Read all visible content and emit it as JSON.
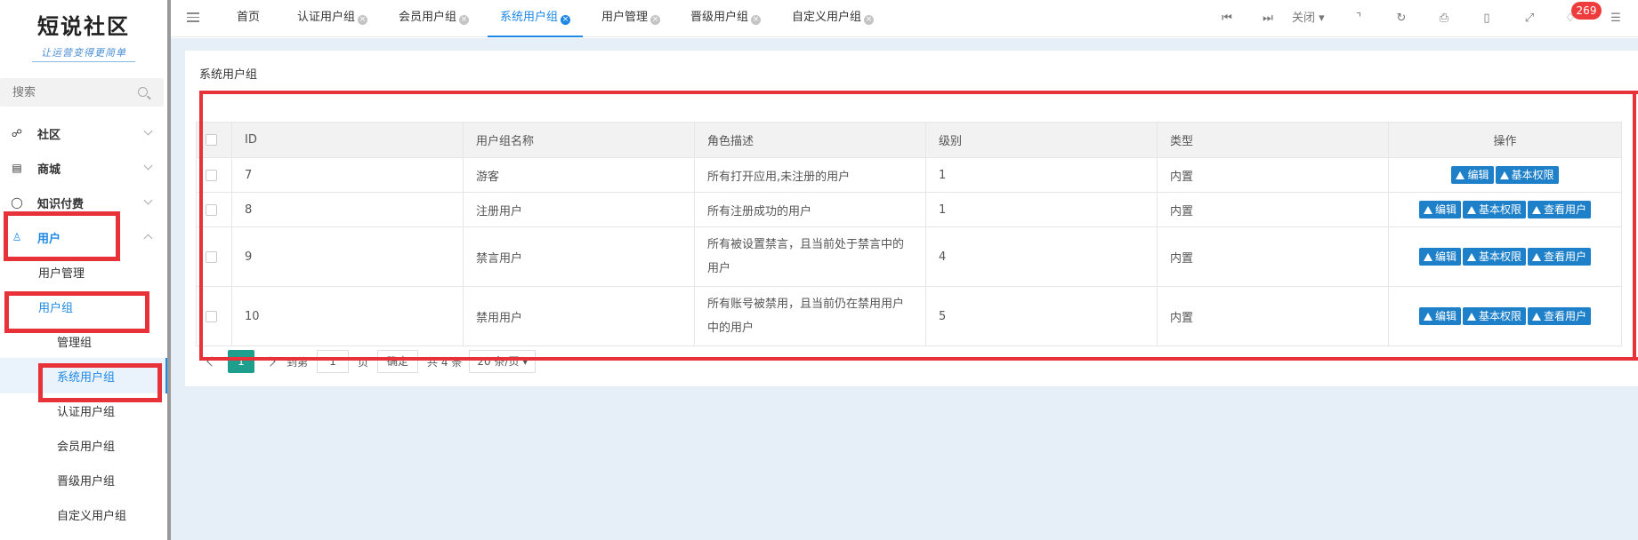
{
  "sidebar": {
    "logo_title": "短说社区",
    "logo_subtitle": "让运营变得更简单",
    "search_placeholder": "搜索",
    "menu": [
      {
        "label": "社区",
        "icon": "chat-icon"
      },
      {
        "label": "商城",
        "icon": "store-icon"
      },
      {
        "label": "知识付费",
        "icon": "bulb-icon"
      },
      {
        "label": "用户",
        "icon": "user-icon"
      }
    ],
    "submenu": {
      "user_manage": "用户管理",
      "user_group": "用户组",
      "groups": [
        "管理组",
        "系统用户组",
        "认证用户组",
        "会员用户组",
        "晋级用户组",
        "自定义用户组"
      ]
    }
  },
  "topbar": {
    "tabs": [
      "首页",
      "认证用户组",
      "会员用户组",
      "系统用户组",
      "用户管理",
      "晋级用户组",
      "自定义用户组"
    ],
    "active_tab": "系统用户组",
    "close_label": "关闭",
    "notification_count": "269",
    "colors": {
      "accent": "#1e88e5",
      "badge": "#ee3b3b"
    }
  },
  "main": {
    "panel_title": "系统用户组",
    "table": {
      "columns": [
        "ID",
        "用户组名称",
        "角色描述",
        "级别",
        "类型",
        "操作"
      ],
      "rows": [
        {
          "id": "7",
          "name": "游客",
          "desc": "所有打开应用,未注册的用户",
          "level": "1",
          "type": "内置"
        },
        {
          "id": "8",
          "name": "注册用户",
          "desc": "所有注册成功的用户",
          "level": "1",
          "type": "内置"
        },
        {
          "id": "9",
          "name": "禁言用户",
          "desc": "所有被设置禁言，且当前处于禁言中的用户",
          "level": "4",
          "type": "内置"
        },
        {
          "id": "10",
          "name": "禁用用户",
          "desc": "所有账号被禁用，且当前仍在禁用用户中的用户",
          "level": "5",
          "type": "内置"
        }
      ],
      "actions": {
        "edit": "编辑",
        "permission": "基本权限",
        "view_users": "查看用户"
      }
    },
    "pager": {
      "current_page": "1",
      "goto_prefix": "到第",
      "goto_value": "1",
      "goto_suffix": "页",
      "confirm": "确定",
      "total": "共 4 条",
      "page_size": "20 条/页"
    }
  }
}
